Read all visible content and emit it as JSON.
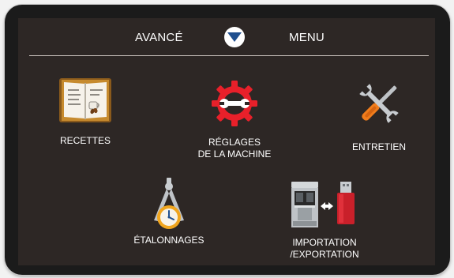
{
  "header": {
    "left_tab": "AVANCÉ",
    "right_tab": "MENU",
    "toggle_icon": "mode-toggle-icon"
  },
  "menu": {
    "items": [
      {
        "id": "recettes",
        "label": "RECETTES",
        "icon": "recipe-book-icon"
      },
      {
        "id": "reglages",
        "label_lines": [
          "RÉGLAGES",
          "DE LA MACHINE"
        ],
        "icon": "gear-wrench-icon"
      },
      {
        "id": "entretien",
        "label": "ENTRETIEN",
        "icon": "tools-icon"
      },
      {
        "id": "etalonnages",
        "label": "ÉTALONNAGES",
        "icon": "calibration-compass-clock-icon"
      },
      {
        "id": "import_export",
        "label_lines": [
          "IMPORTATION",
          "/EXPORTATION"
        ],
        "icon": "machine-usb-transfer-icon"
      }
    ]
  },
  "colors": {
    "screen_background": "#2d2725",
    "bezel": "#1b1b1b",
    "accent_blue": "#1f4f8f",
    "gear_red": "#e8202a",
    "tool_orange": "#f07c1b",
    "book_gold": "#c68a2e"
  }
}
